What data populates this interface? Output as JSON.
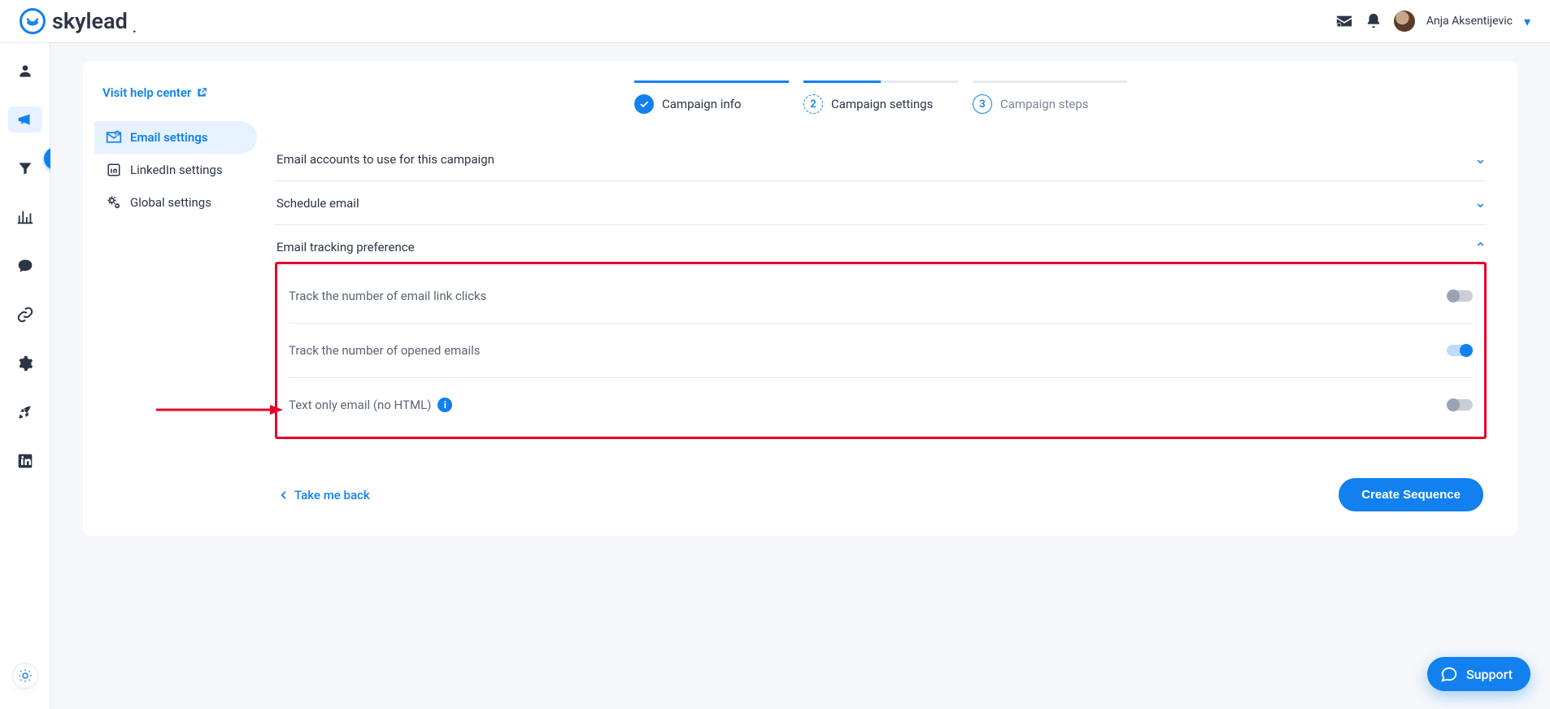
{
  "brand": "skylead",
  "user": {
    "name": "Anja Aksentijevic"
  },
  "help_link": "Visit help center",
  "sidebar": {
    "items": [
      {
        "label": "Email settings",
        "icon": "mail-at"
      },
      {
        "label": "LinkedIn settings",
        "icon": "linkedin-box"
      },
      {
        "label": "Global settings",
        "icon": "gears"
      }
    ]
  },
  "stepper": {
    "steps": [
      {
        "label": "Campaign info",
        "state": "done"
      },
      {
        "label": "Campaign settings",
        "num": "2",
        "state": "current"
      },
      {
        "label": "Campaign steps",
        "num": "3",
        "state": "pending"
      }
    ]
  },
  "groups": {
    "accounts": {
      "title": "Email accounts to use for this campaign"
    },
    "schedule": {
      "title": "Schedule email"
    },
    "tracking": {
      "title": "Email tracking preference"
    }
  },
  "tracking": {
    "link_clicks": {
      "label": "Track the number of email link clicks",
      "on": false
    },
    "opened": {
      "label": "Track the number of opened emails",
      "on": true
    },
    "text_only": {
      "label": "Text only email (no HTML)",
      "on": false
    }
  },
  "footer": {
    "back": "Take me back",
    "cta": "Create Sequence"
  },
  "support": "Support"
}
